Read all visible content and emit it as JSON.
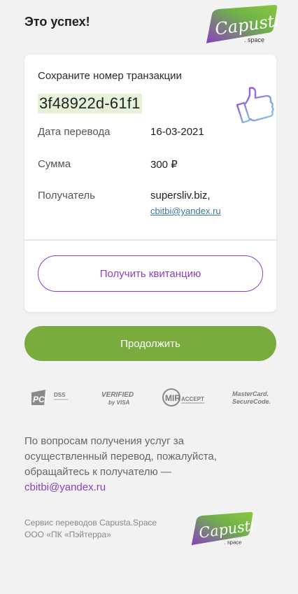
{
  "header": {
    "title": "Это успех!",
    "logo_text": "Capusta",
    "logo_sub": ". space"
  },
  "card": {
    "save_label": "Сохраните номер транзакции",
    "transaction_id": "3f48922d-61f1",
    "rows": [
      {
        "label": "Дата перевода",
        "value": "16-03-2021"
      },
      {
        "label": "Сумма",
        "value": "300 ₽"
      },
      {
        "label": "Получатель",
        "value": "supersliv.biz,",
        "link": "cbitbi@yandex.ru"
      }
    ],
    "receipt_button": "Получить квитанцию"
  },
  "continue_button": "Продолжить",
  "badges": {
    "pci": "PCI",
    "dss": "DSS",
    "verified_1": "VERIFIED",
    "verified_2": "by VISA",
    "mir": "MIR",
    "mir_accept": "ACCEPT",
    "mc_1": "MasterCard.",
    "mc_2": "SecureCode."
  },
  "info": {
    "text": "По вопросам получения услуг за осуществленный перевод, пожалуйста, обращайтесь к получателю —",
    "email": "cbitbi@yandex.ru"
  },
  "footer": {
    "line1": "Сервис переводов Capusta.Space",
    "line2": "ООО «ПК «Пэйтерра»"
  },
  "colors": {
    "accent_purple": "#8a3fbf",
    "accent_green": "#7aab3e",
    "txid_highlight": "#e5f1d9",
    "link_blue": "#3b7a96"
  },
  "icons": [
    "capusta-logo",
    "thumbs-up-icon",
    "pci-dss-badge",
    "verified-by-visa-badge",
    "mir-accept-badge",
    "mastercard-securecode-badge"
  ]
}
